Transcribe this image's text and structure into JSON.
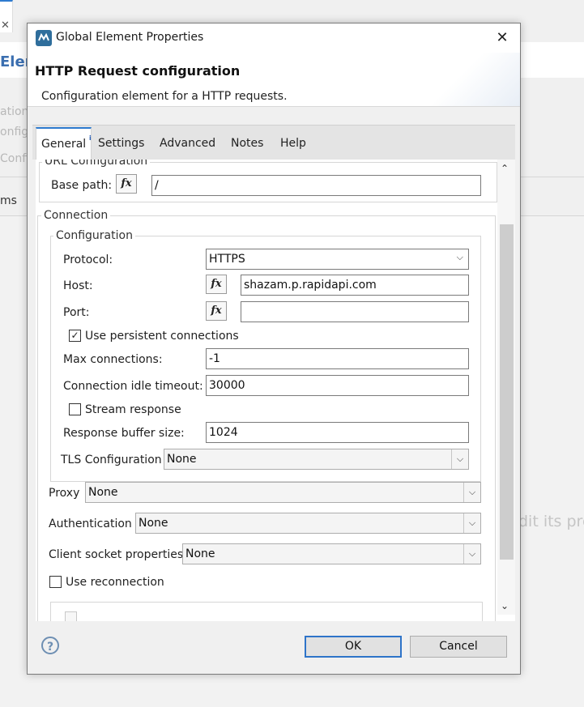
{
  "background": {
    "title_fragment": "Elem",
    "sub_lines": [
      "ation",
      "onfig",
      "Config"
    ],
    "items_fragment": "ms",
    "hint_fragment": "dit its pro"
  },
  "dialog": {
    "window_title": "Global Element Properties",
    "close_glyph": "✕",
    "header_title": "HTTP Request configuration",
    "header_description": "Configuration element for a HTTP requests.",
    "tabs": [
      "General",
      "Settings",
      "Advanced",
      "Notes",
      "Help"
    ],
    "active_tab": "General",
    "url_config": {
      "legend": "URL Configuration",
      "base_path_label": "Base path:",
      "base_path_value": "/"
    },
    "connection": {
      "legend": "Connection",
      "configuration_legend": "Configuration",
      "protocol_label": "Protocol:",
      "protocol_value": "HTTPS",
      "host_label": "Host:",
      "host_value": "shazam.p.rapidapi.com",
      "port_label": "Port:",
      "port_value": "",
      "persistent_label": "Use persistent connections",
      "persistent_checked": true,
      "max_connections_label": "Max connections:",
      "max_connections_value": "-1",
      "idle_timeout_label": "Connection idle timeout:",
      "idle_timeout_value": "30000",
      "stream_label": "Stream response",
      "stream_checked": false,
      "buffer_label": "Response buffer size:",
      "buffer_value": "1024",
      "tls_label": "TLS Configuration",
      "tls_value": "None",
      "proxy_label": "Proxy",
      "proxy_value": "None",
      "auth_label": "Authentication",
      "auth_value": "None",
      "socket_label": "Client socket properties",
      "socket_value": "None",
      "reconnection_label": "Use reconnection",
      "reconnection_checked": false
    },
    "fx_glyph": "fx",
    "check_glyph": "✓",
    "chevron_glyph": "⌵",
    "scroll_up_glyph": "⌃",
    "scroll_down_glyph": "⌄",
    "help_glyph": "?",
    "ok_label": "OK",
    "cancel_label": "Cancel"
  },
  "colors": {
    "accent": "#2e7bcf",
    "dialog_bg": "#f0f0f0",
    "help_icon": "#6e8fb3"
  },
  "icons": {
    "app_icon": "mule-studio-icon",
    "help": "help-circle-icon",
    "info": "info-badge-icon"
  }
}
